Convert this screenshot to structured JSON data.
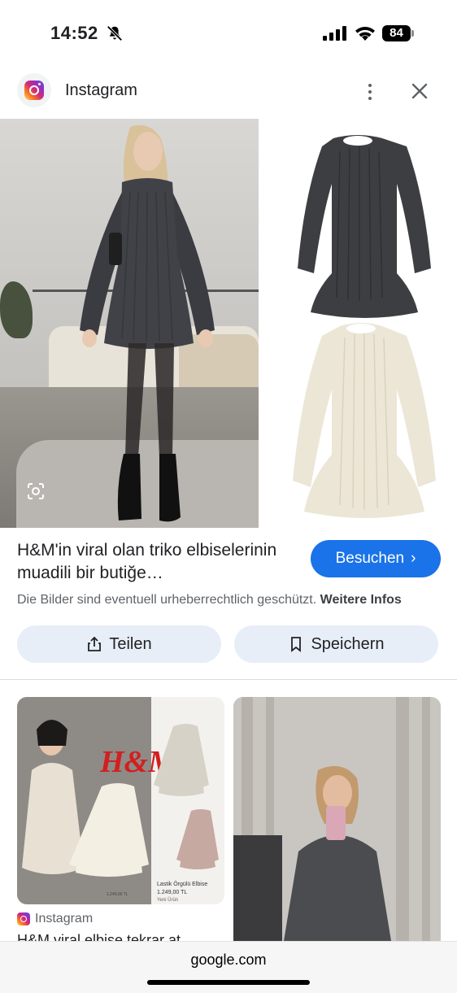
{
  "status_bar": {
    "time": "14:52",
    "battery": "84",
    "icons": [
      "bell-slash-icon",
      "cellular-signal-icon",
      "wifi-icon",
      "battery-icon"
    ]
  },
  "source": {
    "name": "Instagram",
    "logo_icon": "instagram-logo-icon",
    "menu_icon": "more-vert-icon",
    "close_icon": "close-icon"
  },
  "result": {
    "title": "H&M'in viral olan triko elbiselerinin muadili bir butiğe…",
    "visit_label": "Besuchen",
    "copyright_text": "Die Bilder sind eventuell urheberrechtlich geschützt.",
    "more_info_label": "Weitere Infos",
    "share_label": "Teilen",
    "save_label": "Speichern"
  },
  "related": [
    {
      "source": "Instagram",
      "caption": "H&M viral elbise tekrar at",
      "image_text": {
        "brand": "H&M",
        "product": "Lastik Örgülü Elbise",
        "price": "1.249,00 TL",
        "tag": "Yeni Ürün",
        "left_price": "1.249,00 TL"
      }
    },
    {
      "source": "",
      "caption": ""
    }
  ],
  "bottom_bar": {
    "url": "google.com"
  },
  "colors": {
    "accent": "#1a73e8",
    "button_bg": "#e8eef8",
    "text_primary": "#202124",
    "text_secondary": "#5f6368"
  }
}
